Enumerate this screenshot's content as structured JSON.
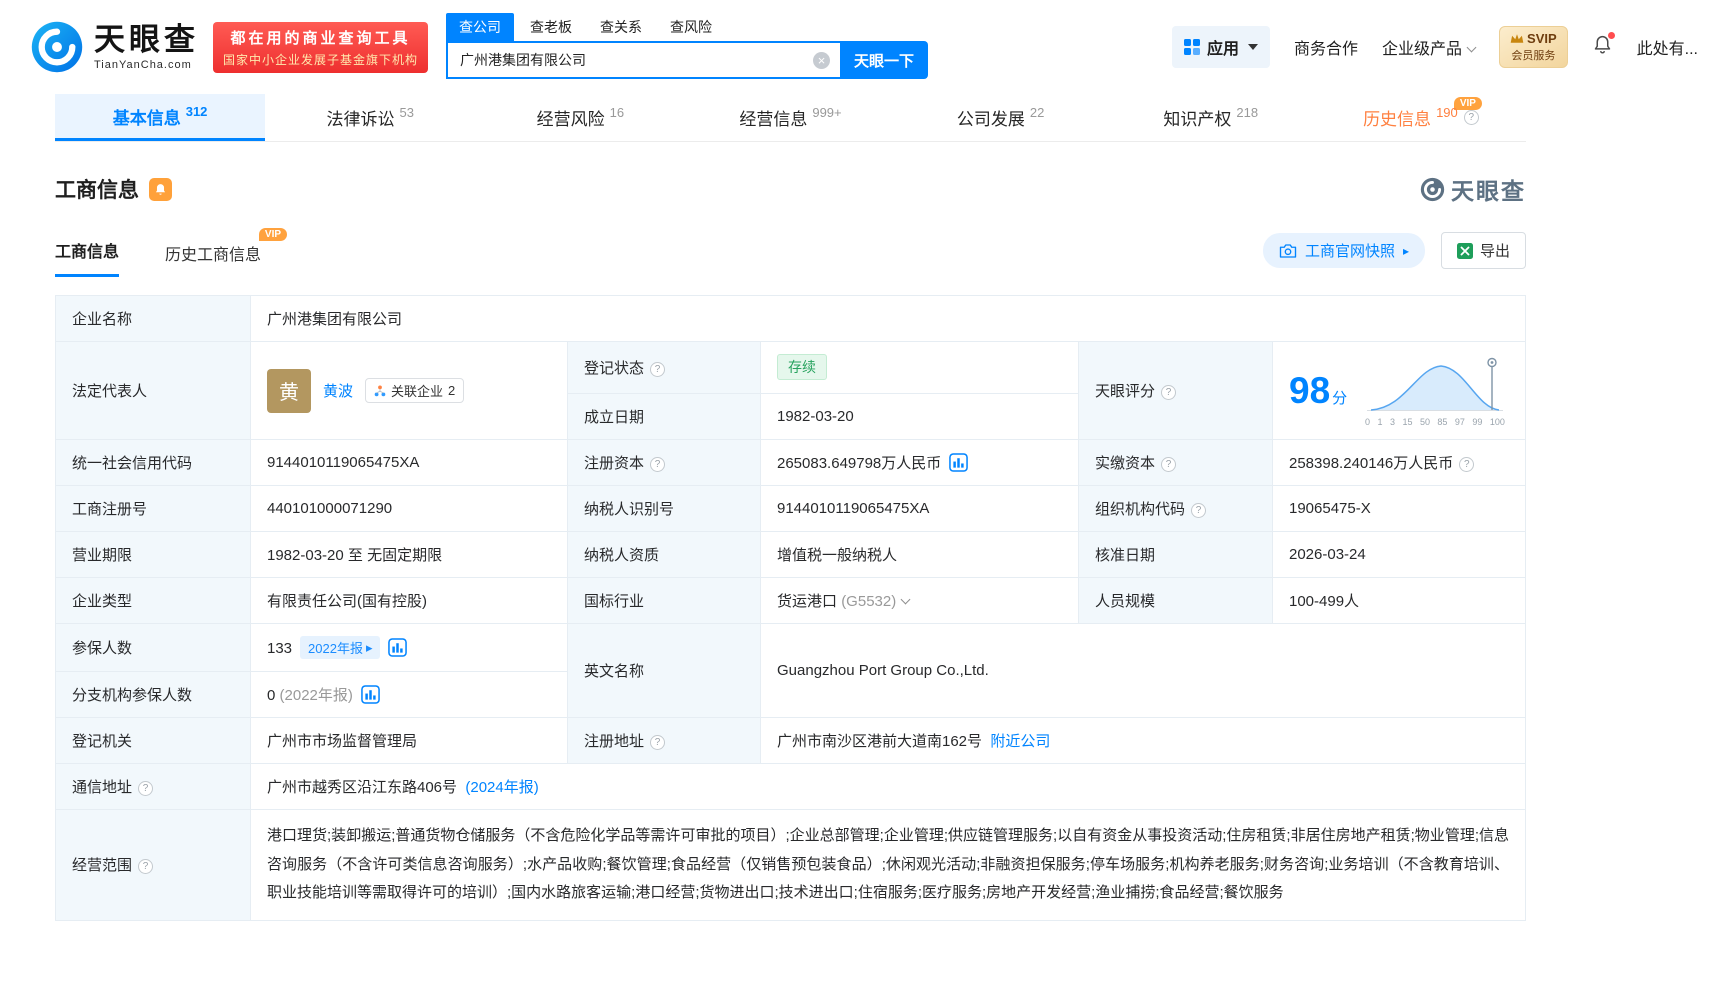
{
  "brand": {
    "name": "天眼查",
    "domain": "TianYanCha.com",
    "accent_color": "#0084ff",
    "vip_orange": "#ffa23e",
    "status_green": "#28a35f"
  },
  "icons": {
    "help_glyph": "?",
    "clear_glyph": "×",
    "arrow_right_glyph": "▸",
    "export_x_glyph": "X"
  },
  "header": {
    "promo": {
      "line1": "都在用的商业查询工具",
      "line2": "国家中小企业发展子基金旗下机构"
    },
    "search_tabs": [
      {
        "label": "查公司"
      },
      {
        "label": "查老板"
      },
      {
        "label": "查关系"
      },
      {
        "label": "查风险"
      }
    ],
    "search": {
      "value": "广州港集团有限公司",
      "button_label": "天眼一下"
    },
    "nav": {
      "apps_label": "应用",
      "cooperation_label": "商务合作",
      "enterprise_label": "企业级产品",
      "svip_line1": "SVIP",
      "svip_line2": "会员服务",
      "more_label": "此处有..."
    }
  },
  "tabs": [
    {
      "label": "基本信息",
      "count": "312"
    },
    {
      "label": "法律诉讼",
      "count": "53"
    },
    {
      "label": "经营风险",
      "count": "16"
    },
    {
      "label": "经营信息",
      "count": "999+"
    },
    {
      "label": "公司发展",
      "count": "22"
    },
    {
      "label": "知识产权",
      "count": "218"
    },
    {
      "label": "历史信息",
      "count": "190",
      "vip": "VIP"
    }
  ],
  "section": {
    "title": "工商信息",
    "watermark": "天眼查",
    "sub_tabs": [
      {
        "label": "工商信息"
      },
      {
        "label": "历史工商信息",
        "vip": "VIP"
      }
    ],
    "snapshot_label": "工商官网快照",
    "export_label": "导出"
  },
  "info": {
    "company_name": {
      "label": "企业名称",
      "value": "广州港集团有限公司"
    },
    "legal_rep": {
      "label": "法定代表人",
      "avatar": "黄",
      "name": "黄波",
      "related_label": "关联企业",
      "related_count": "2"
    },
    "reg_status": {
      "label": "登记状态",
      "value": "存续"
    },
    "est_date": {
      "label": "成立日期",
      "value": "1982-03-20"
    },
    "score": {
      "label": "天眼评分",
      "value": "98",
      "unit": "分",
      "ticks": [
        "0",
        "1",
        "3",
        "15",
        "50",
        "85",
        "97",
        "99",
        "100"
      ]
    },
    "credit_code": {
      "label": "统一社会信用代码",
      "value": "9144010119065475XA"
    },
    "reg_capital": {
      "label": "注册资本",
      "value": "265083.649798万人民币"
    },
    "paid_capital": {
      "label": "实缴资本",
      "value": "258398.240146万人民币"
    },
    "reg_number": {
      "label": "工商注册号",
      "value": "440101000071290"
    },
    "taxpayer_id": {
      "label": "纳税人识别号",
      "value": "9144010119065475XA"
    },
    "org_code": {
      "label": "组织机构代码",
      "value": "19065475-X"
    },
    "business_term": {
      "label": "营业期限",
      "value": "1982-03-20 至 无固定期限"
    },
    "taxpayer_qualification": {
      "label": "纳税人资质",
      "value": "增值税一般纳税人"
    },
    "approval_date": {
      "label": "核准日期",
      "value": "2026-03-24"
    },
    "company_type": {
      "label": "企业类型",
      "value": "有限责任公司(国有控股)"
    },
    "industry": {
      "label": "国标行业",
      "value": "货运港口",
      "code": "(G5532)"
    },
    "staff_size": {
      "label": "人员规模",
      "value": "100-499人"
    },
    "insured": {
      "label": "参保人数",
      "value": "133",
      "report_badge": "2022年报"
    },
    "english_name": {
      "label": "英文名称",
      "value": "Guangzhou Port Group Co.,Ltd."
    },
    "branch_insured": {
      "label": "分支机构参保人数",
      "value": "0",
      "report_note": "(2022年报)"
    },
    "reg_authority": {
      "label": "登记机关",
      "value": "广州市市场监督管理局"
    },
    "reg_address": {
      "label": "注册地址",
      "value": "广州市南沙区港前大道南162号",
      "nearby_link": "附近公司"
    },
    "mail_address": {
      "label": "通信地址",
      "value": "广州市越秀区沿江东路406号",
      "report_link": "(2024年报)"
    },
    "business_scope": {
      "label": "经营范围",
      "value": "港口理货;装卸搬运;普通货物仓储服务（不含危险化学品等需许可审批的项目）;企业总部管理;企业管理;供应链管理服务;以自有资金从事投资活动;住房租赁;非居住房地产租赁;物业管理;信息咨询服务（不含许可类信息咨询服务）;水产品收购;餐饮管理;食品经营（仅销售预包装食品）;休闲观光活动;非融资担保服务;停车场服务;机构养老服务;财务咨询;业务培训（不含教育培训、职业技能培训等需取得许可的培训）;国内水路旅客运输;港口经营;货物进出口;技术进出口;住宿服务;医疗服务;房地产开发经营;渔业捕捞;食品经营;餐饮服务"
    }
  }
}
